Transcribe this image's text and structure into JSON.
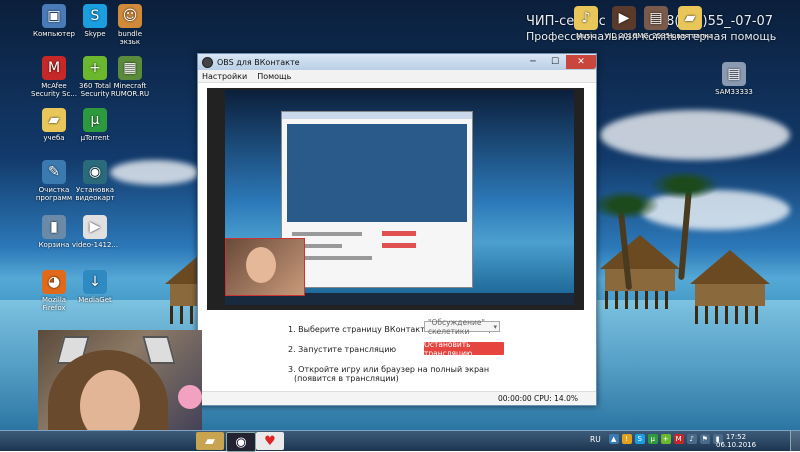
{
  "branding": {
    "line1": "ЧИП-сервис",
    "phone": "Т. 8(5_2)55_-07-07",
    "line2": "Профессиональная компьютерная помощь"
  },
  "desktop_icons": [
    {
      "label": "Компьютер",
      "icon": "computer-icon",
      "color": "#4a7ab8",
      "glyph": "▣"
    },
    {
      "label": "Skype",
      "icon": "skype-icon",
      "color": "#1a9ee0",
      "glyph": "S"
    },
    {
      "label": "bundle\nэкзьк",
      "icon": "toy-icon",
      "color": "#d08a3a",
      "glyph": "☺"
    },
    {
      "label": "McAfee\nSecurity Sc...",
      "icon": "mcafee-icon",
      "color": "#c62828",
      "glyph": "M"
    },
    {
      "label": "360 Total\nSecurity",
      "icon": "360-security-icon",
      "color": "#6bb82e",
      "glyph": "+"
    },
    {
      "label": "Minecraft\nRUMOR.RU",
      "icon": "minecraft-icon",
      "color": "#5a8a3a",
      "glyph": "▦"
    },
    {
      "label": "учеба",
      "icon": "folder-icon",
      "color": "#e8c65a",
      "glyph": "▰"
    },
    {
      "label": "µTorrent",
      "icon": "utorrent-icon",
      "color": "#2e9a3e",
      "glyph": "µ"
    },
    {
      "label": "Очистка\nпрограмм",
      "icon": "cleaner-icon",
      "color": "#3a7ab0",
      "glyph": "✎"
    },
    {
      "label": "Установка\nвидеокарт",
      "icon": "driver-icon",
      "color": "#2a6a7a",
      "glyph": "◉"
    },
    {
      "label": "Корзина",
      "icon": "recycle-bin-icon",
      "color": "#6b8aa8",
      "glyph": "▮"
    },
    {
      "label": "video-1412...",
      "icon": "video-file-icon",
      "color": "#e0e0e0",
      "glyph": "▶"
    },
    {
      "label": "Mozilla\nFirefox",
      "icon": "firefox-icon",
      "color": "#e06a1a",
      "glyph": "◕"
    },
    {
      "label": "MediaGet",
      "icon": "mediaget-icon",
      "color": "#2e8ac0",
      "glyph": "↓"
    }
  ],
  "desktop_right_icons": [
    {
      "label": "Music",
      "icon": "music-folder-icon",
      "color": "#e8c65a",
      "glyph": "♪"
    },
    {
      "label": "VID 2016...",
      "icon": "video-thumb-icon",
      "color": "#5a3a2a",
      "glyph": "▶"
    },
    {
      "label": "IMG_2535...",
      "icon": "image-thumb-icon",
      "color": "#7a5a4a",
      "glyph": "▤"
    },
    {
      "label": "Новая папка",
      "icon": "new-folder-icon",
      "color": "#e8c65a",
      "glyph": "▰"
    },
    {
      "label": "SAM33333",
      "icon": "photo-thumb-icon",
      "color": "#8a9ab0",
      "glyph": "▤"
    }
  ],
  "window": {
    "title": "OBS для ВКонтакте",
    "minimize": "─",
    "maximize": "☐",
    "close": "✕",
    "menu": [
      "Настройки",
      "Помощь"
    ]
  },
  "controls": {
    "step1": "1. Выберите страницу ВКонтакте для трансляции",
    "select_value": "\"Обсуждение\" скелетики",
    "step2": "2. Запустите трансляцию",
    "stop_label": "Остановить трансляцию",
    "step3_line1": "3. Откройте игру или браузер на полный экран",
    "step3_line2": "(появится в трансляции)"
  },
  "status": {
    "time": "00:00:00",
    "cpu": "CPU: 14.0%"
  },
  "taskbar": {
    "lang": "RU",
    "clock_time": "17:52",
    "clock_date": "06.10.2016"
  },
  "colors": {
    "accent_red": "#e6453f",
    "window_border": "#6b8fb5",
    "taskbar": "#1c3550"
  }
}
